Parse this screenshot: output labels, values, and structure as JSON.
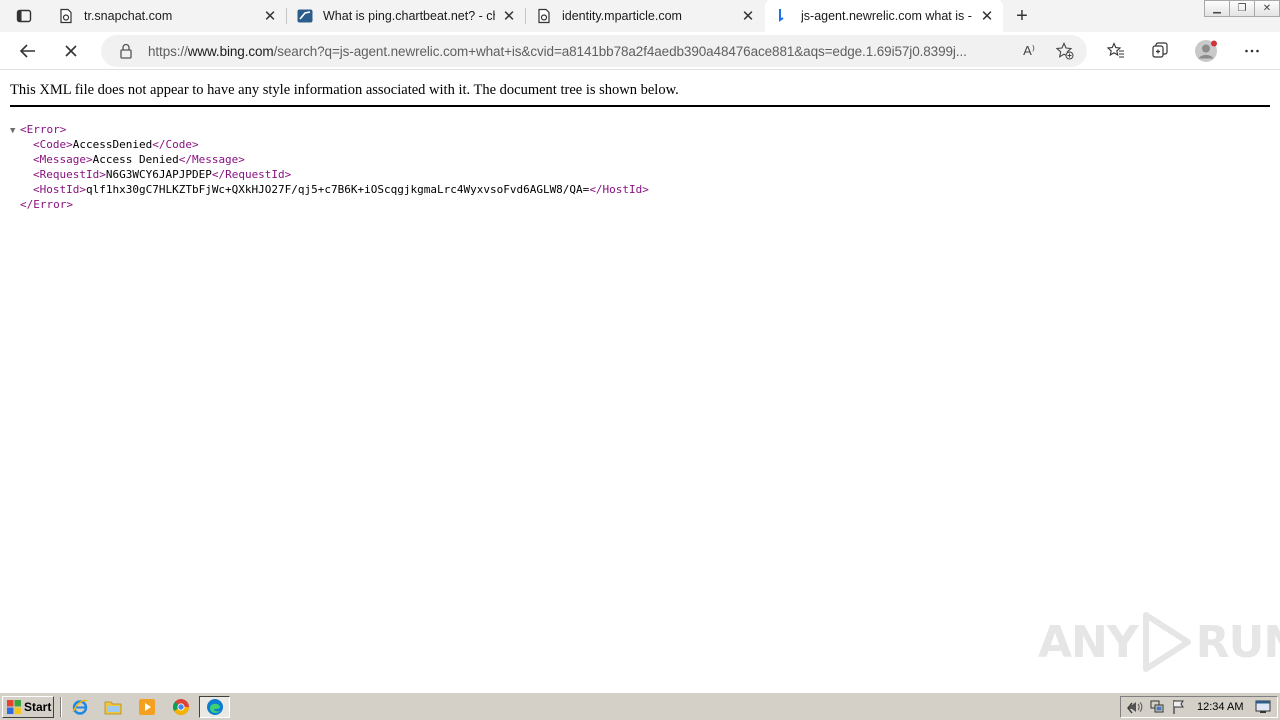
{
  "browser": {
    "tabs": [
      {
        "title": "tr.snapchat.com",
        "icon": "document-icon",
        "active": false
      },
      {
        "title": "What is ping.chartbeat.net? - cha",
        "icon": "chartbeat-icon",
        "active": false
      },
      {
        "title": "identity.mparticle.com",
        "icon": "document-icon",
        "active": false
      },
      {
        "title": "js-agent.newrelic.com what is - S",
        "icon": "bing-icon",
        "active": true
      }
    ],
    "new_tab_label": "+",
    "address": {
      "scheme": "https://",
      "host": "www.bing.com",
      "path": "/search?q=js-agent.newrelic.com+what+is&cvid=a8141bb78a2f4aedb390a48476ace881&aqs=edge.1.69i57j0.8399j..."
    },
    "read_aloud_label": "A⁾"
  },
  "page": {
    "info": "This XML file does not appear to have any style information associated with it. The document tree is shown below.",
    "xml": {
      "root_open": "<Error>",
      "root_close": "</Error>",
      "toggle": "▼",
      "children": [
        {
          "open": "<Code>",
          "value": "AccessDenied",
          "close": "</Code>"
        },
        {
          "open": "<Message>",
          "value": "Access Denied",
          "close": "</Message>"
        },
        {
          "open": "<RequestId>",
          "value": "N6G3WCY6JAPJPDEP",
          "close": "</RequestId>"
        },
        {
          "open": "<HostId>",
          "value": "qlf1hx30gC7HLKZTbFjWc+QXkHJO27F/qj5+c7B6K+iOScqgjkgmaLrc4WyxvsoFvd6AGLW8/QA=",
          "close": "</HostId>"
        }
      ]
    },
    "watermark": {
      "left": "ANY",
      "right": "RUN"
    }
  },
  "taskbar": {
    "start_label": "Start",
    "clock": "12:34 AM"
  },
  "colors": {
    "tag": "#881280",
    "taskbar": "#d4d0c8",
    "tabstrip": "#f3f3f3",
    "address_bg": "#f1f1f1"
  }
}
